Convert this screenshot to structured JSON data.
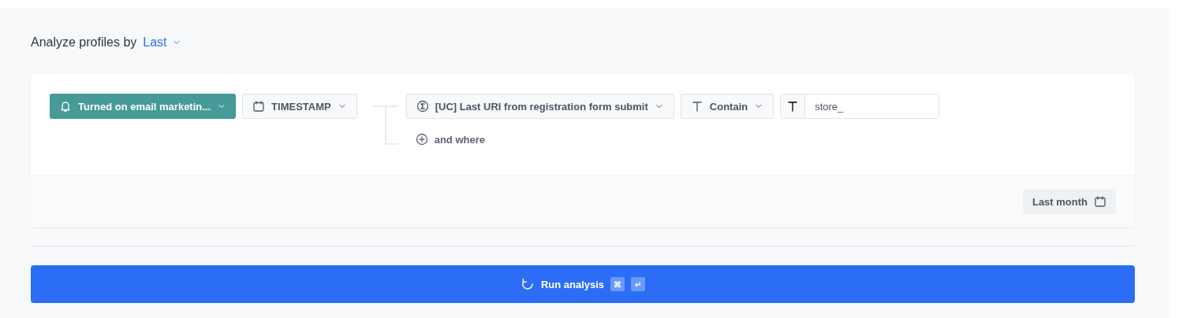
{
  "heading": {
    "label": "Analyze profiles by",
    "mode": "Last"
  },
  "filter": {
    "event": "Turned on email marketin...",
    "parameter": "TIMESTAMP",
    "conditions": [
      {
        "attribute": "[UC] Last URI from registration form submit",
        "operator": "Contain",
        "value": "store_"
      }
    ],
    "add_label": "and where"
  },
  "date_range": "Last month",
  "run": {
    "label": "Run analysis",
    "keys": [
      "⌘",
      "↵"
    ]
  }
}
